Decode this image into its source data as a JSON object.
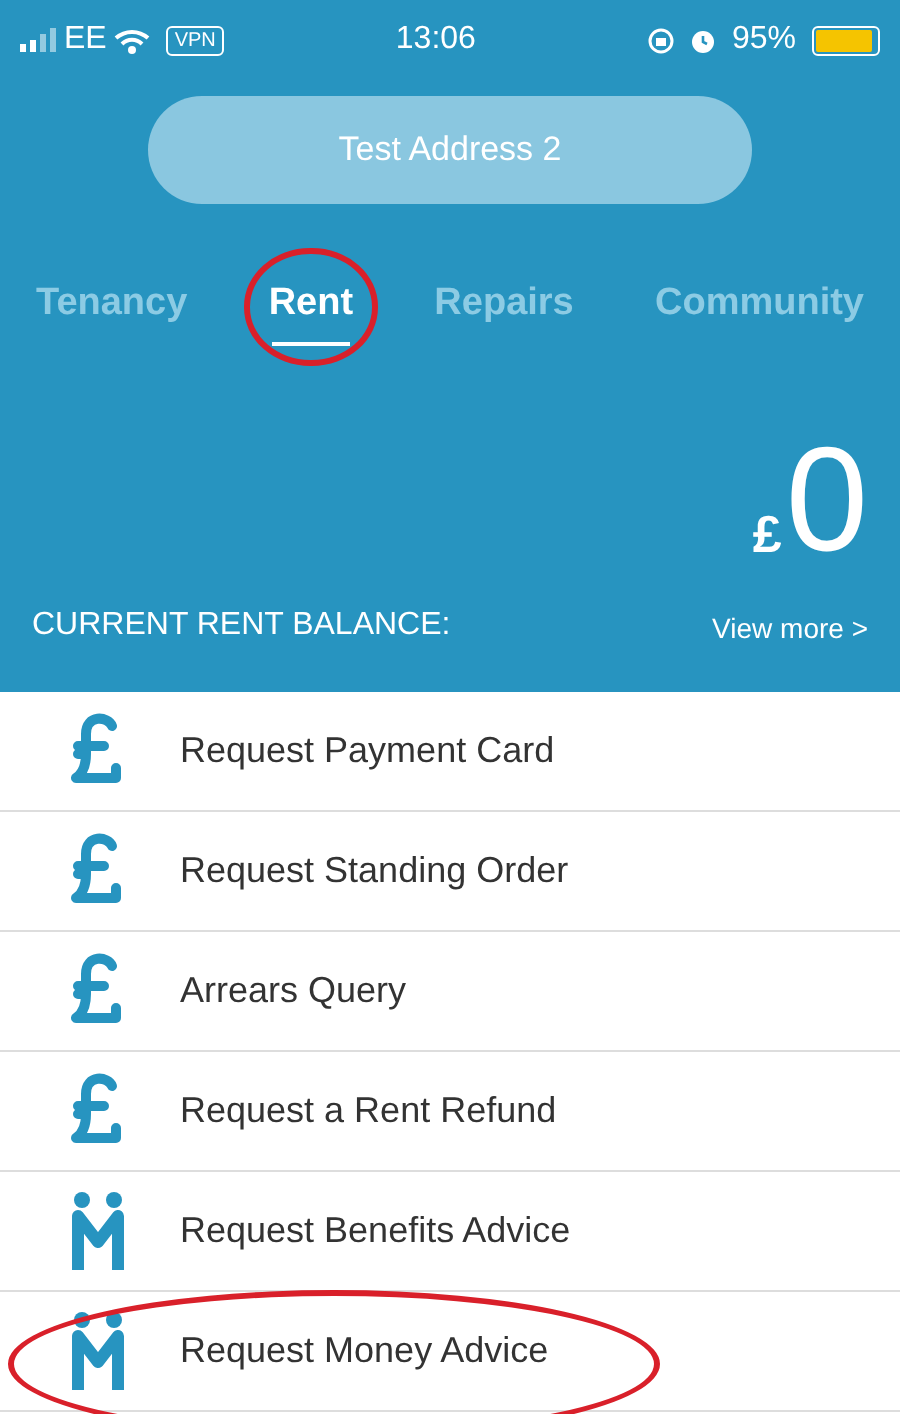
{
  "status_bar": {
    "carrier": "EE",
    "vpn": "VPN",
    "time": "13:06",
    "battery": "95%"
  },
  "address_button": "Test Address 2",
  "tabs": [
    {
      "label": "Tenancy",
      "selected": false,
      "circled": false
    },
    {
      "label": "Rent",
      "selected": true,
      "circled": true
    },
    {
      "label": "Repairs",
      "selected": false,
      "circled": false
    },
    {
      "label": "Community",
      "selected": false,
      "circled": false
    }
  ],
  "balance": {
    "currency": "£",
    "amount": "0",
    "label": "CURRENT RENT BALANCE:",
    "link": "View more >"
  },
  "items": [
    {
      "label": "Request Payment Card",
      "kind": "pound",
      "circled": false
    },
    {
      "label": "Request Standing Order",
      "kind": "pound",
      "circled": false
    },
    {
      "label": "Arrears Query",
      "kind": "pound",
      "circled": false
    },
    {
      "label": "Request a Rent Refund",
      "kind": "pound",
      "circled": false
    },
    {
      "label": "Request Benefits Advice",
      "kind": "people",
      "circled": false
    },
    {
      "label": "Request Money Advice",
      "kind": "people",
      "circled": true
    }
  ]
}
